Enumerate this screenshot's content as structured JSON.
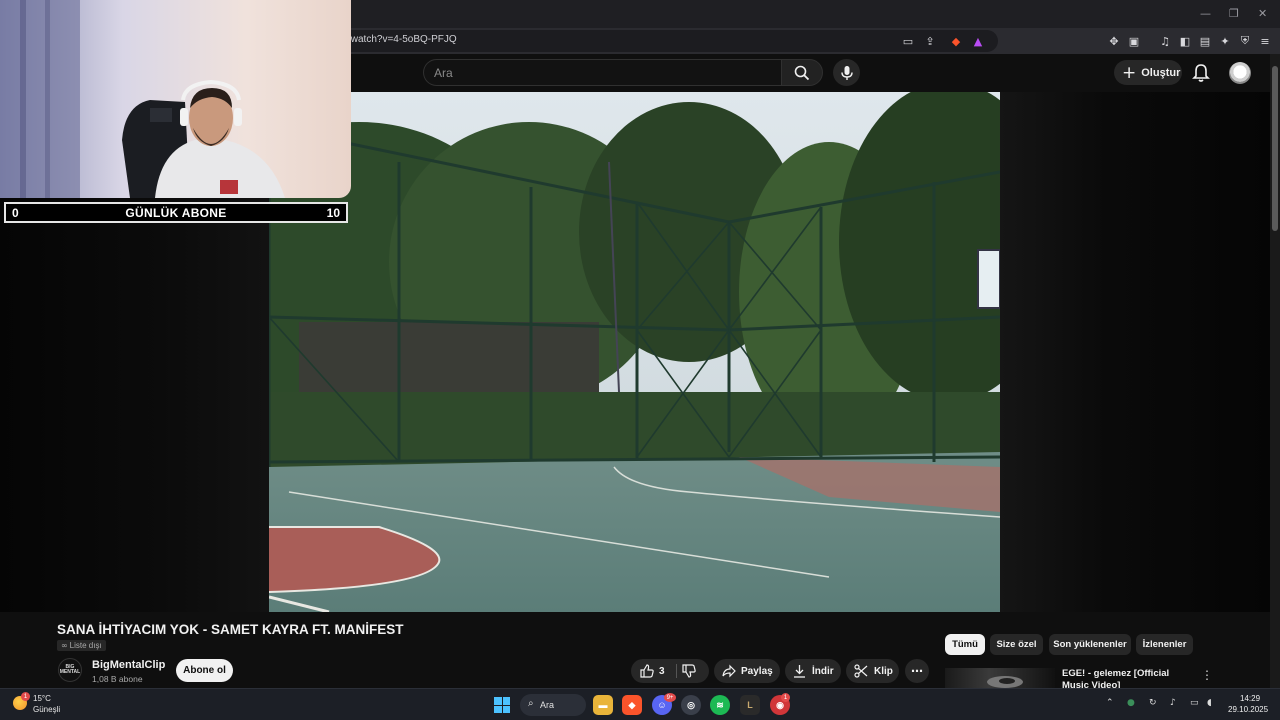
{
  "browser": {
    "url": "/watch?v=4-5oBQ-PFJQ",
    "window_controls": [
      "—",
      "❐",
      "✕"
    ]
  },
  "masthead": {
    "search_placeholder": "Ara",
    "create_label": "Oluştur"
  },
  "overlay": {
    "counter_left": "0",
    "counter_label": "GÜNLÜK ABONE",
    "counter_right": "10"
  },
  "video": {
    "title": "SANA İHTİYACIM YOK - SAMET KAYRA FT. MANİFEST",
    "visibility": "Liste dışı",
    "channel_name": "BigMentalClip",
    "channel_subs": "1,08 B abone",
    "channel_logo_text": "BIG MENTAL",
    "subscribe_label": "Abone ol",
    "like_count": "3",
    "share_label": "Paylaş",
    "download_label": "İndir",
    "clip_label": "Klip"
  },
  "chips": [
    "Tümü",
    "Size özel",
    "Son yüklenenler",
    "İzlenenler"
  ],
  "recommendation": {
    "title": "EGE! - gelemez [Official Music Video]"
  },
  "taskbar": {
    "weather_temp": "15°C",
    "weather_cond": "Güneşli",
    "weather_badge": "1",
    "search_label": "Ara",
    "discord_badge": "9+",
    "red_app_badge": "1",
    "clock_time": "14:29",
    "clock_date": "29.10.2025"
  },
  "colors": {
    "youtube_bg": "#0f0f0f",
    "chip_active": "#f1f1f1",
    "taskbar_bg": "#1c1f26",
    "accent_blue": "#4cc2ff"
  }
}
